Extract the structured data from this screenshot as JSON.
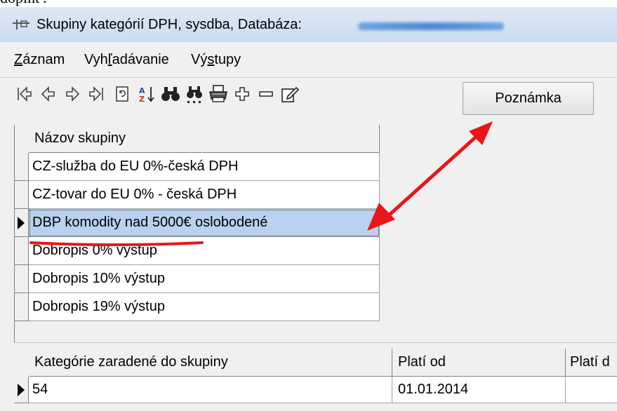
{
  "top_fragment": "doplnť?",
  "window": {
    "title": "Skupiny kategórií DPH, sysdba,  Databáza:"
  },
  "menu": [
    {
      "label": "Záznam",
      "accel_index": 0
    },
    {
      "label": "Vyhľadávanie",
      "accel_index": 3
    },
    {
      "label": "Výstupy",
      "accel_index": 2
    }
  ],
  "toolbar": {
    "icons": [
      "first-record-icon",
      "prev-record-icon",
      "next-record-icon",
      "last-record-icon",
      "refresh-icon",
      "sort-icon",
      "find-icon",
      "find-next-icon",
      "print-icon",
      "add-icon",
      "delete-icon",
      "edit-icon"
    ],
    "note_button": "Poznámka"
  },
  "groups_table": {
    "header": "Názov skupiny",
    "rows": [
      "CZ-služba do EU 0%-česká DPH",
      "CZ-tovar do EU 0% - česká DPH",
      "DBP komodity nad 5000€ oslobodené",
      "Dobropis 0%  výstup",
      "Dobropis 10% výstup",
      "Dobropis 19% výstup"
    ],
    "selected_row": 2
  },
  "categories_table": {
    "headers": [
      "Kategórie zaradené do skupiny",
      "Platí od",
      "Platí d"
    ],
    "rows": [
      [
        "54",
        "01.01.2014",
        ""
      ]
    ]
  },
  "colors": {
    "annotation": "#e8161b",
    "selection": "#b9d1ee"
  }
}
